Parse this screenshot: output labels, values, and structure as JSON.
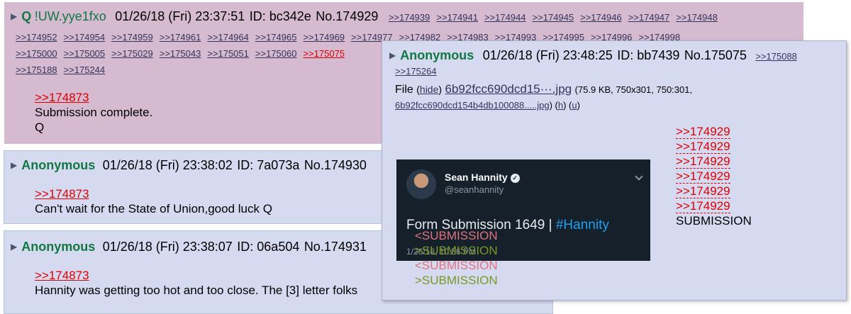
{
  "post_q": {
    "name": "Q",
    "trip": "!UW.yye1fxo",
    "datetime": "01/26/18 (Fri) 23:37:51",
    "id": "ID: bc342e",
    "no": "No.174929",
    "backlinks_row1": [
      ">>174939",
      ">>174941",
      ">>174944",
      ">>174945",
      ">>174946",
      ">>174947",
      ">>174948"
    ],
    "backlinks_row2": [
      ">>174952",
      ">>174954",
      ">>174959",
      ">>174961",
      ">>174964",
      ">>174965",
      ">>174969",
      ">>174977",
      ">>174982",
      ">>174983",
      ">>174993",
      ">>174995",
      ">>174996",
      ">>174998"
    ],
    "backlinks_row3": [
      ">>175000",
      ">>175005",
      ">>175029",
      ">>175043",
      ">>175051",
      ">>175060",
      ">>175075"
    ],
    "backlinks_row4": [
      ">>175188",
      ">>175244"
    ],
    "quote": ">>174873",
    "text_lines": [
      "Submission complete.",
      "Q"
    ]
  },
  "post_a1": {
    "name": "Anonymous",
    "datetime": "01/26/18 (Fri) 23:38:02",
    "id": "ID: 7a073a",
    "no": "No.174930",
    "quote": ">>174873",
    "text": "Can't wait for the State of Union,good luck Q"
  },
  "post_a2": {
    "name": "Anonymous",
    "datetime": "01/26/18 (Fri) 23:38:07",
    "id": "ID: 06a504",
    "no": "No.174931",
    "quote": ">>174873",
    "text": "Hannity was getting too hot and too close. The [3] letter folks"
  },
  "post_hover": {
    "name": "Anonymous",
    "datetime": "01/26/18 (Fri) 23:48:25",
    "id": "ID: bb7439",
    "no": "No.175075",
    "backlinks": [
      ">>175088",
      ">>175264"
    ],
    "file_label": "File",
    "hide_label": "hide",
    "file_name": "6b92fcc690dcd15···.jpg",
    "file_meta": "(75.9 KB, 750x301, 750:301,",
    "file_fullname": "6b92fcc690dcd154b4db100088.....jpg",
    "file_h": "h",
    "file_u": "u",
    "tweet": {
      "name": "Sean Hannity",
      "handle": "@seanhannity",
      "text": "Form Submission 1649 | ",
      "hashtag": "#Hannity",
      "date": "1/26/18, 10:56 PM"
    },
    "side_quotes": [
      ">>174929",
      ">>174929",
      ">>174929",
      ">>174929",
      ">>174929",
      ">>174929"
    ],
    "side_text": "SUBMISSION",
    "green_lines": [
      "<SUBMISSION",
      ">SUBMISSION",
      "<SUBMISSION",
      ">SUBMISSION"
    ],
    "colors": {
      "green": "#789922",
      "pink": "#e0727f",
      "name_green": "#117743",
      "quote_red": "#dd0000"
    }
  }
}
